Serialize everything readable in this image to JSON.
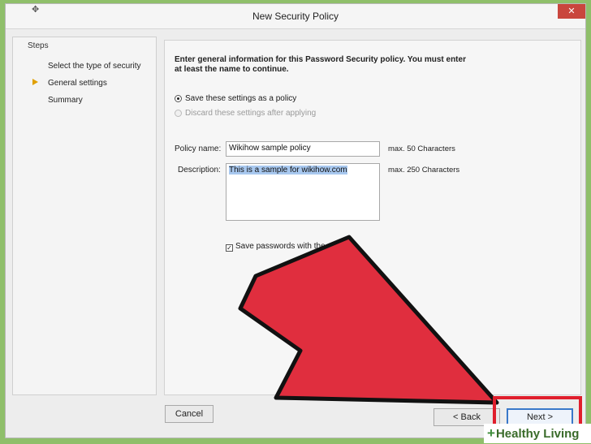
{
  "window": {
    "title": "New Security Policy",
    "close_glyph": "✕",
    "app_icon_glyph": "✥"
  },
  "steps": {
    "heading": "Steps",
    "items": [
      {
        "label": "Select the type of security",
        "current": false
      },
      {
        "label": "General settings",
        "current": true
      },
      {
        "label": "Summary",
        "current": false
      }
    ]
  },
  "content": {
    "intro": "Enter general information for this Password Security policy. You must enter at least the name to continue.",
    "radio_save": "Save these settings as a policy",
    "radio_discard": "Discard these settings after applying",
    "policy_name_label": "Policy name:",
    "policy_name_value": "Wikihow sample policy",
    "policy_name_hint": "max. 50 Characters",
    "description_label": "Description:",
    "description_value": "This is a sample for wikihow.com",
    "description_hint": "max. 250 Characters",
    "save_passwords_label": "Save passwords with the policy",
    "check_glyph": "✓"
  },
  "footer": {
    "cancel": "Cancel",
    "back": "< Back",
    "next": "Next >"
  },
  "overlay": {
    "arrow_color": "#e02e3e",
    "highlight_color": "#e01e2c"
  },
  "watermark": {
    "plus": "+",
    "text": "Healthy Living"
  }
}
